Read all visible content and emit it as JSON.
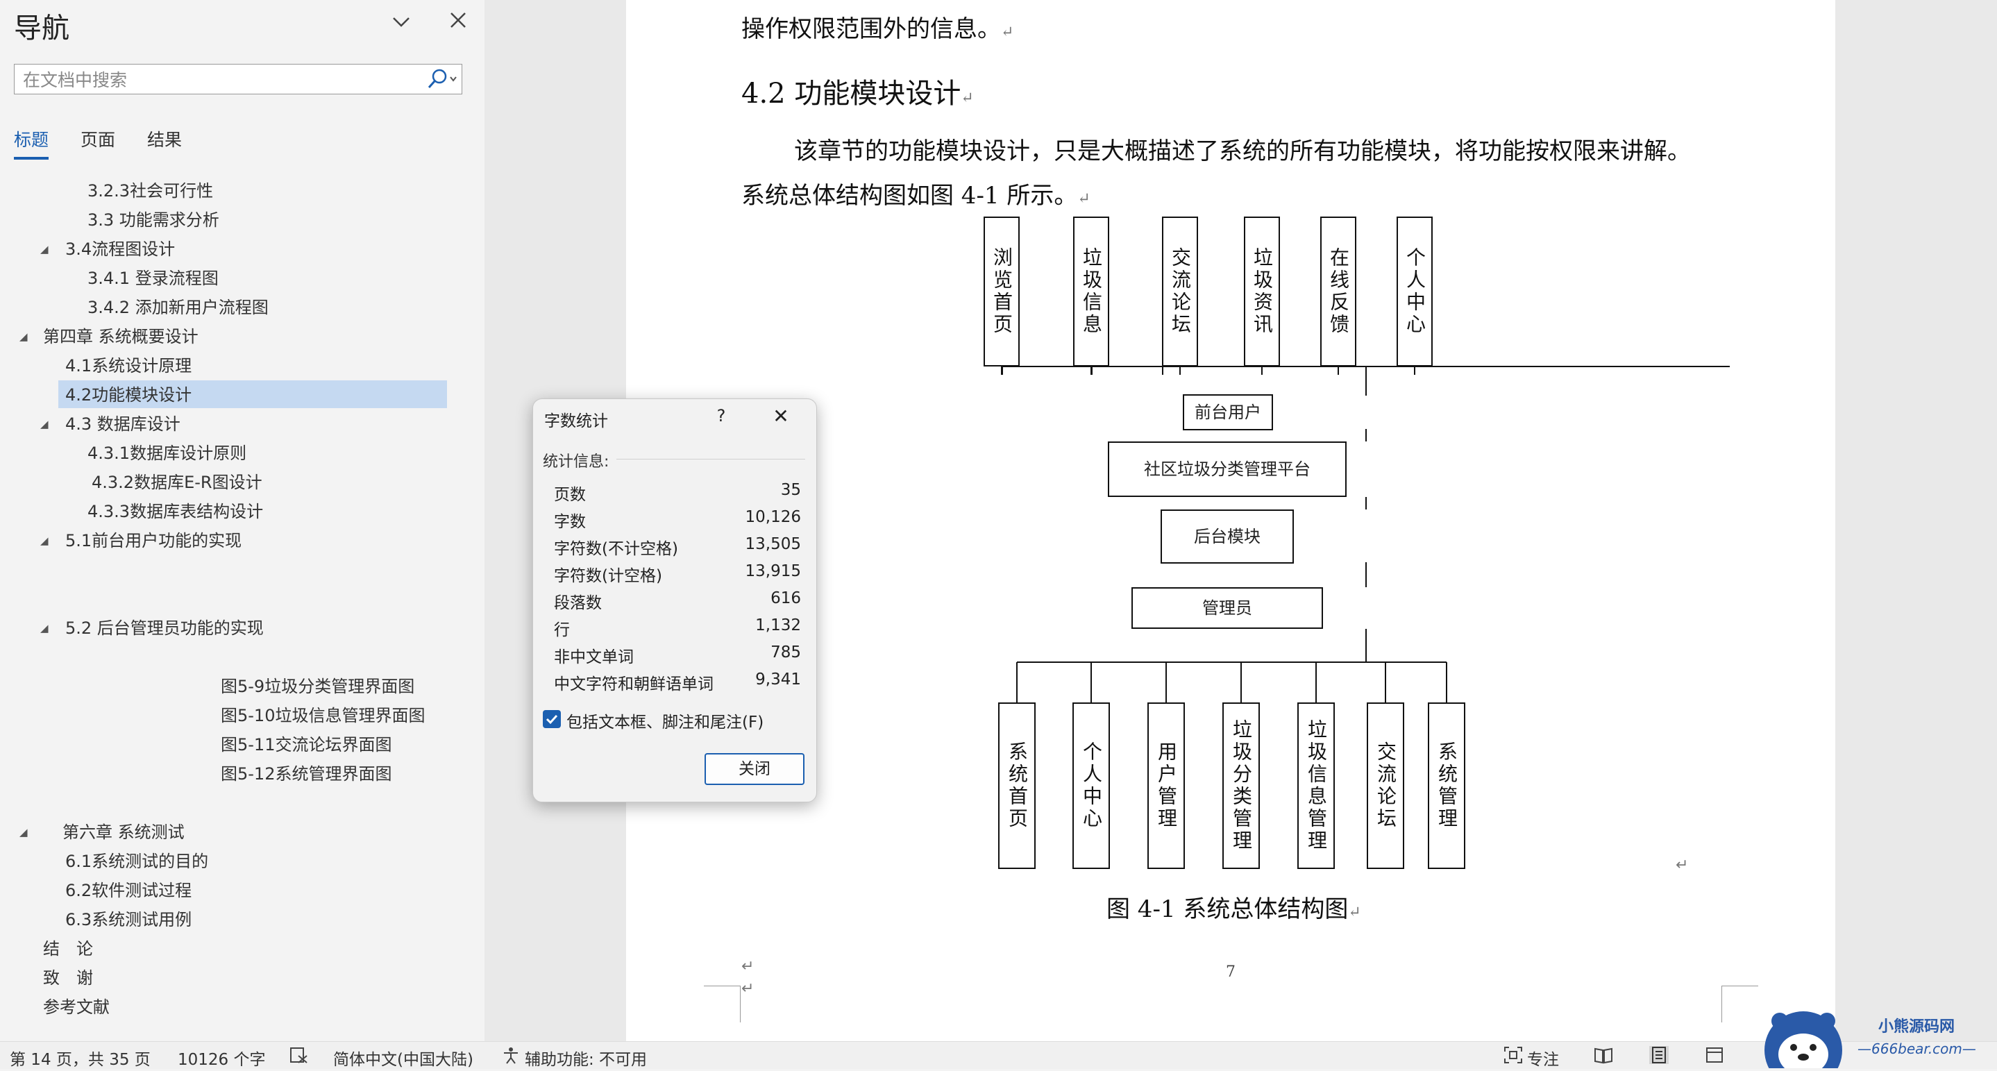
{
  "nav": {
    "title": "导航",
    "search_placeholder": "在文档中搜索",
    "tabs": [
      "标题",
      "页面",
      "结果"
    ],
    "outline": [
      {
        "label": "3.2.3社会可行性"
      },
      {
        "label": "3.3 功能需求分析"
      },
      {
        "label": "3.4流程图设计"
      },
      {
        "label": "3.4.1 登录流程图"
      },
      {
        "label": "3.4.2 添加新用户流程图"
      },
      {
        "label": "第四章 系统概要设计"
      },
      {
        "label": "4.1系统设计原理"
      },
      {
        "label": "4.2功能模块设计",
        "selected": true
      },
      {
        "label": "4.3 数据库设计"
      },
      {
        "label": "4.3.1数据库设计原则"
      },
      {
        "label": "4.3.2数据库E-R图设计"
      },
      {
        "label": "4.3.3数据库表结构设计"
      },
      {
        "label": "5.1前台用户功能的实现"
      },
      {
        "label": "5.2 后台管理员功能的实现"
      },
      {
        "label": "图5-9垃圾分类管理界面图"
      },
      {
        "label": "图5-10垃圾信息管理界面图"
      },
      {
        "label": "图5-11交流论坛界面图"
      },
      {
        "label": "图5-12系统管理界面图"
      },
      {
        "label": "第六章 系统测试"
      },
      {
        "label": "6.1系统测试的目的"
      },
      {
        "label": "6.2软件测试过程"
      },
      {
        "label": "6.3系统测试用例"
      },
      {
        "label": "结　论"
      },
      {
        "label": "致　谢"
      },
      {
        "label": "参考文献"
      }
    ]
  },
  "doc": {
    "line_top": "操作权限范围外的信息。",
    "heading": "4.2 功能模块设计",
    "para1": "该章节的功能模块设计，只是大概描述了系统的所有功能模块，将功能按权限来讲解。",
    "para2": "系统总体结构图如图 4-1 所示。",
    "caption": "图 4-1  系统总体结构图",
    "page_number": "7",
    "return_mark": "↵",
    "diagram": {
      "top_modules": [
        "浏览首页",
        "垃圾信息",
        "交流论坛",
        "垃圾资讯",
        "在线反馈",
        "个人中心"
      ],
      "front_user": "前台用户",
      "platform": "社区垃圾分类管理平台",
      "backend": "后台模块",
      "admin": "管理员",
      "bottom_modules": [
        "系统首页",
        "个人中心",
        "用户管理",
        "垃圾分类管理",
        "垃圾信息管理",
        "交流论坛",
        "系统管理"
      ]
    }
  },
  "dialog": {
    "title": "字数统计",
    "help": "?",
    "close": "✕",
    "section": "统计信息:",
    "stats": [
      {
        "label": "页数",
        "value": "35"
      },
      {
        "label": "字数",
        "value": "10,126"
      },
      {
        "label": "字符数(不计空格)",
        "value": "13,505"
      },
      {
        "label": "字符数(计空格)",
        "value": "13,915"
      },
      {
        "label": "段落数",
        "value": "616"
      },
      {
        "label": "行",
        "value": "1,132"
      },
      {
        "label": "非中文单词",
        "value": "785"
      },
      {
        "label": "中文字符和朝鲜语单词",
        "value": "9,341"
      }
    ],
    "checkbox_label": "包括文本框、脚注和尾注(F)",
    "checkbox_checked": true,
    "close_button": "关闭"
  },
  "status": {
    "page": "第 14 页，共 35 页",
    "words": "10126 个字",
    "language": "简体中文(中国大陆)",
    "accessibility": "辅助功能: 不可用",
    "focus": "专注"
  },
  "watermark": {
    "line1": "小熊源码网",
    "line2": "—666bear.com—"
  },
  "colors": {
    "accent": "#1b5fb0",
    "selected_bg": "#c5d9f1"
  }
}
